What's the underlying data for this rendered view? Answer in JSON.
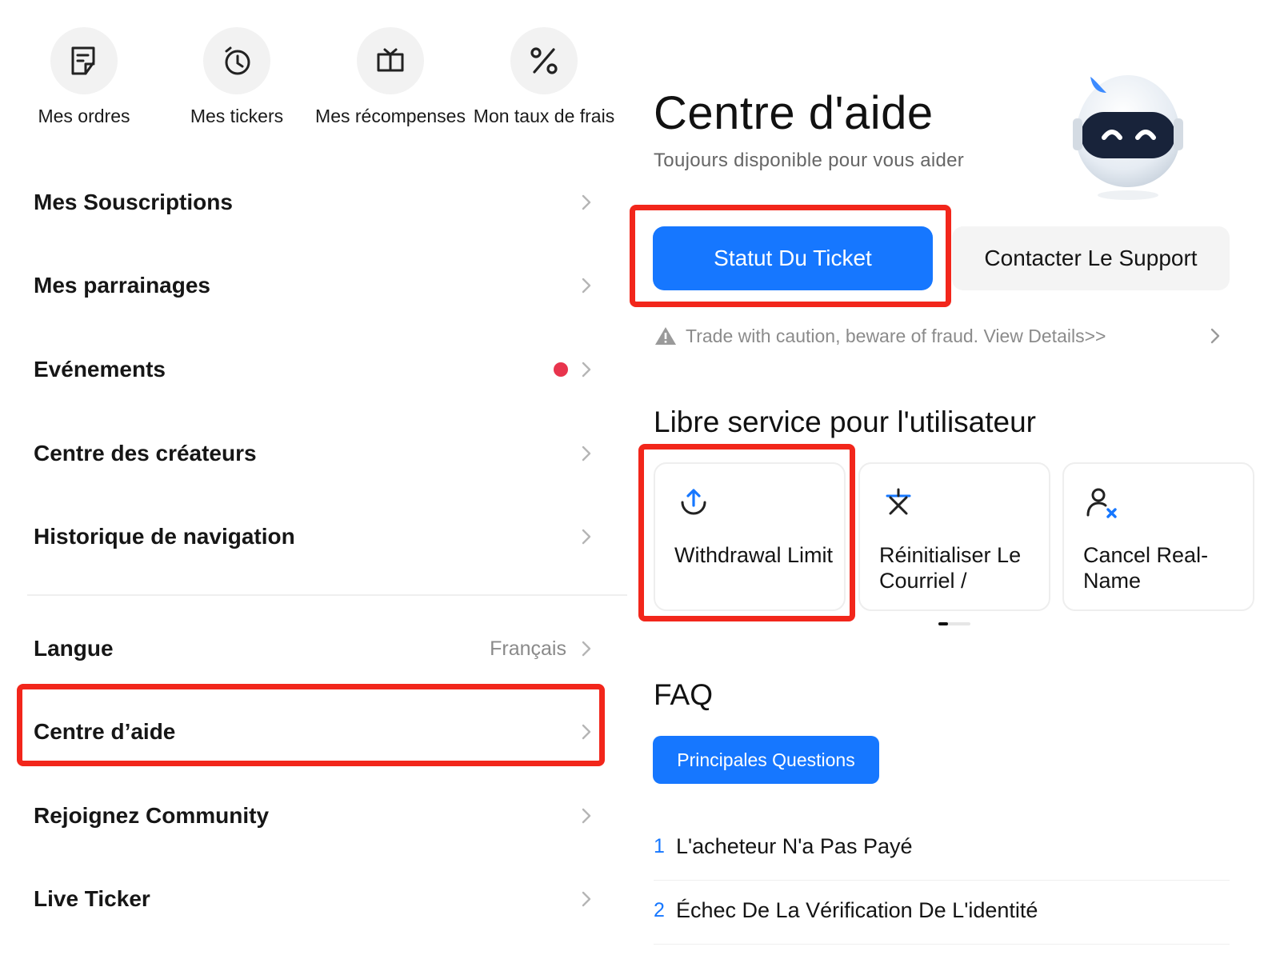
{
  "quick_actions": [
    {
      "label": "Mes ordres",
      "icon": "orders-icon"
    },
    {
      "label": "Mes tickers",
      "icon": "clock-icon"
    },
    {
      "label": "Mes récompenses",
      "icon": "gift-icon"
    },
    {
      "label": "Mon taux de frais",
      "icon": "percent-icon"
    }
  ],
  "menu": {
    "items": [
      {
        "label": "Mes Souscriptions"
      },
      {
        "label": "Mes parrainages"
      },
      {
        "label": "Evénements",
        "has_dot": true
      },
      {
        "label": "Centre des créateurs"
      },
      {
        "label": "Historique de navigation"
      },
      {
        "label": "Langue",
        "value": "Français"
      },
      {
        "label": "Centre d’aide",
        "highlighted": true
      },
      {
        "label": "Rejoignez Community"
      },
      {
        "label": "Live Ticker"
      }
    ]
  },
  "help_center": {
    "title": "Centre d'aide",
    "subtitle": "Toujours disponible pour vous aider",
    "ticket_button": "Statut Du Ticket",
    "support_button": "Contacter Le Support",
    "warning": "Trade with caution, beware of fraud. View Details>>",
    "self_service_title": "Libre service pour l'utilisateur",
    "cards": [
      {
        "label": "Withdrawal Limit",
        "icon": "withdraw-icon"
      },
      {
        "label": "Réinitialiser Le Courriel /",
        "icon": "reset-icon"
      },
      {
        "label": "Cancel Real-Name",
        "icon": "user-cancel-icon"
      }
    ],
    "faq_title": "FAQ",
    "faq_tab": "Principales Questions",
    "faq_items": [
      {
        "num": "1",
        "text": "L'acheteur N'a Pas Payé"
      },
      {
        "num": "2",
        "text": "Échec De La Vérification De L'identité"
      }
    ]
  },
  "colors": {
    "accent": "#1677ff",
    "highlight_box": "#f2261b",
    "notification_dot": "#e8344d"
  }
}
